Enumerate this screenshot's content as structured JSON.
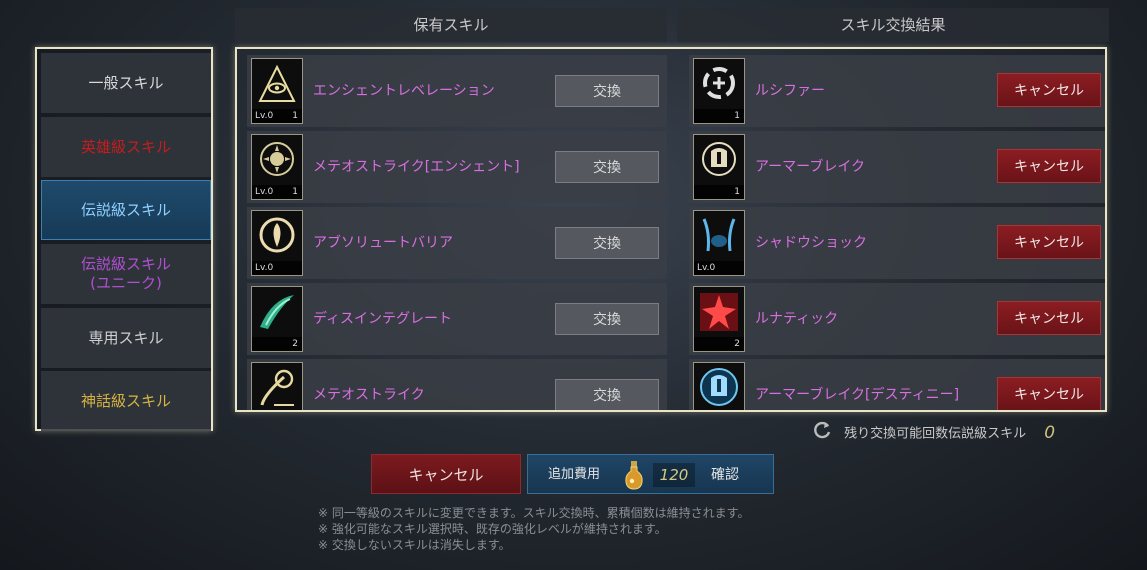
{
  "columns": {
    "owned": "保有スキル",
    "result": "スキル交換結果"
  },
  "categories": [
    {
      "label": "一般スキル",
      "color": "#d8d8d8"
    },
    {
      "label": "英雄級スキル",
      "color": "#c21e1e"
    },
    {
      "label": "伝説級スキル",
      "color": "#8fd0ff"
    },
    {
      "label": "伝説級スキル\n(ユニーク)",
      "color": "#b04fd0"
    },
    {
      "label": "専用スキル",
      "color": "#cfcfcf"
    },
    {
      "label": "神話級スキル",
      "color": "#d6b443"
    }
  ],
  "owned_skills": [
    {
      "name": "エンシェントレベレーション",
      "level": "Lv.0",
      "count": "1",
      "icon": "eye-pyramid-icon",
      "button": "交換"
    },
    {
      "name": "メテオストライク[エンシェント]",
      "level": "Lv.0",
      "count": "1",
      "icon": "meteor-sun-icon",
      "button": "交換"
    },
    {
      "name": "アブソリュートバリア",
      "level": "Lv.0",
      "count": "",
      "icon": "barrier-icon",
      "button": "交換"
    },
    {
      "name": "ディスインテグレート",
      "level": "",
      "count": "2",
      "icon": "disintegrate-icon",
      "button": "交換"
    },
    {
      "name": "メテオストライク",
      "level": "",
      "count": "",
      "icon": "meteor-icon",
      "button": "交換"
    }
  ],
  "result_skills": [
    {
      "name": "ルシファー",
      "level": "",
      "count": "1",
      "icon": "lucifer-icon",
      "button": "キャンセル"
    },
    {
      "name": "アーマーブレイク",
      "level": "",
      "count": "1",
      "icon": "armor-break-icon",
      "button": "キャンセル"
    },
    {
      "name": "シャドウショック",
      "level": "Lv.0",
      "count": "",
      "icon": "shadow-shock-icon",
      "button": "キャンセル"
    },
    {
      "name": "ルナティック",
      "level": "",
      "count": "2",
      "icon": "lunatic-icon",
      "button": "キャンセル"
    },
    {
      "name": "アーマーブレイク[デスティニー]",
      "level": "",
      "count": "",
      "icon": "armor-break-destiny-icon",
      "button": "キャンセル"
    }
  ],
  "remaining": {
    "label": "残り交換可能回数伝説級スキル",
    "value": "0"
  },
  "footer": {
    "cancel_label": "キャンセル",
    "cost_label": "追加費用",
    "cost_value": "120",
    "confirm_label": "確認"
  },
  "notes": [
    "※ 同一等級のスキルに変更できます。スキル交換時、累積個数は維持されます。",
    "※ 強化可能なスキル選択時、既存の強化レベルが維持されます。",
    "※ 交換しないスキルは消失します。"
  ]
}
